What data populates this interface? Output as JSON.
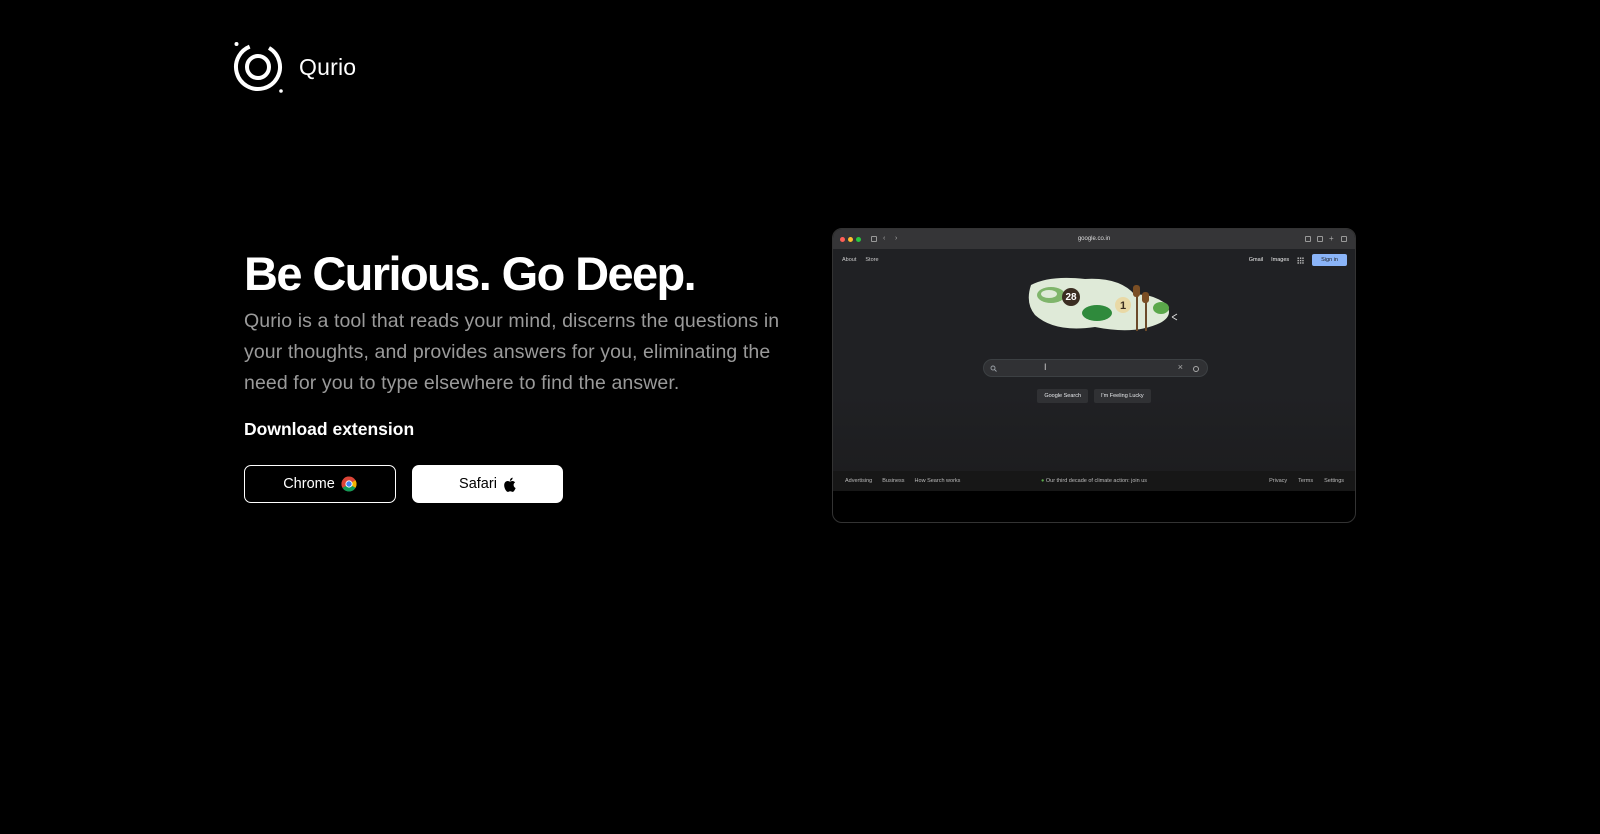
{
  "brand": {
    "name": "Qurio"
  },
  "hero": {
    "title": "Be Curious. Go Deep.",
    "description": "Qurio is a tool that reads your mind, discerns the questions in your thoughts, and provides answers for you, eliminating the need for you to type elsewhere to find the answer.",
    "download_heading": "Download extension",
    "buttons": {
      "chrome_label": "Chrome",
      "safari_label": "Safari"
    }
  },
  "preview": {
    "url": "google.co.in",
    "nav_left": [
      "About",
      "Store"
    ],
    "nav_right": [
      "Gmail",
      "Images"
    ],
    "sign_in": "Sign in",
    "doodle_numbers": [
      "28",
      "1"
    ],
    "search_buttons": [
      "Google Search",
      "I'm Feeling Lucky"
    ],
    "footer_left": [
      "Advertising",
      "Business",
      "How Search works"
    ],
    "footer_center": "Our third decade of climate action: join us",
    "footer_right": [
      "Privacy",
      "Terms",
      "Settings"
    ]
  },
  "colors": {
    "background": "#000000",
    "text": "#ffffff",
    "muted": "#9a9a9a",
    "signin": "#8ab4f8"
  }
}
